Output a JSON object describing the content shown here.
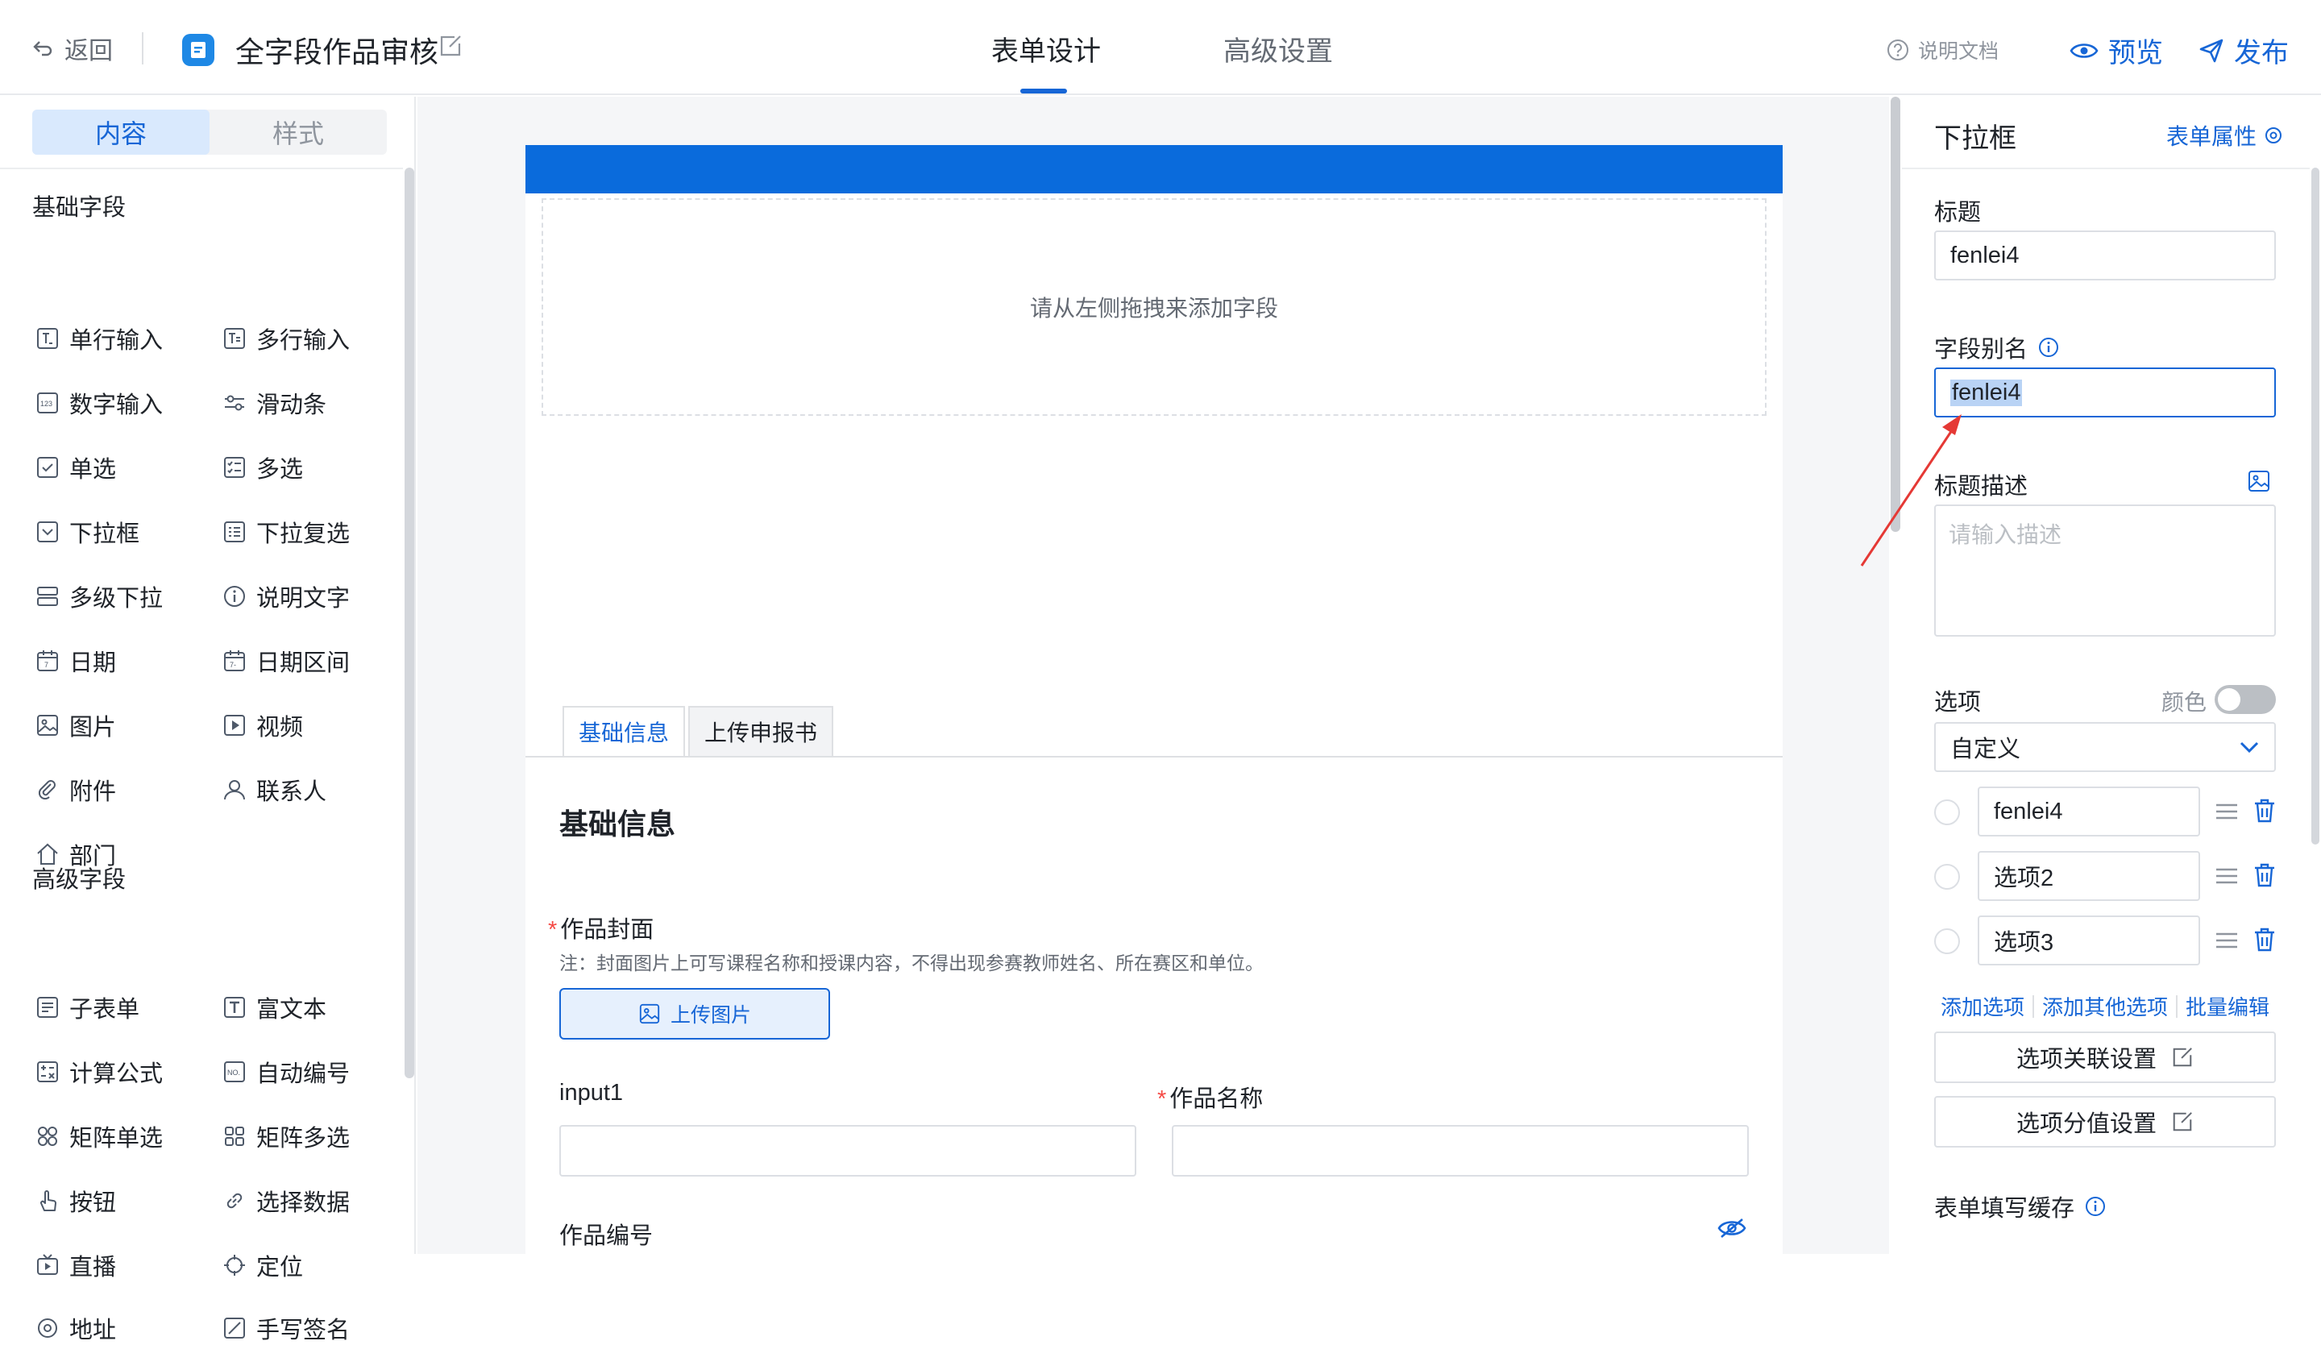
{
  "header": {
    "back_label": "返回",
    "app_title": "全字段作品审核",
    "tabs": [
      {
        "label": "表单设计"
      },
      {
        "label": "高级设置"
      }
    ],
    "active_tab": "表单设计",
    "help_label": "说明文档",
    "preview_label": "预览",
    "publish_label": "发布",
    "accent_color": "#1766d6"
  },
  "left_panel": {
    "tabs": [
      {
        "label": "内容"
      },
      {
        "label": "样式"
      }
    ],
    "basic_title": "基础字段",
    "basic_fields": [
      {
        "label": "单行输入",
        "icon": "text-input-icon"
      },
      {
        "label": "多行输入",
        "icon": "textarea-icon"
      },
      {
        "label": "数字输入",
        "icon": "number-icon"
      },
      {
        "label": "滑动条",
        "icon": "slider-icon"
      },
      {
        "label": "单选",
        "icon": "radio-icon"
      },
      {
        "label": "多选",
        "icon": "checkbox-icon"
      },
      {
        "label": "下拉框",
        "icon": "dropdown-icon"
      },
      {
        "label": "下拉复选",
        "icon": "dropdown-multi-icon"
      },
      {
        "label": "多级下拉",
        "icon": "cascader-icon"
      },
      {
        "label": "说明文字",
        "icon": "info-icon"
      },
      {
        "label": "日期",
        "icon": "date-icon"
      },
      {
        "label": "日期区间",
        "icon": "date-range-icon"
      },
      {
        "label": "图片",
        "icon": "image-icon"
      },
      {
        "label": "视频",
        "icon": "video-icon"
      },
      {
        "label": "附件",
        "icon": "paperclip-icon"
      },
      {
        "label": "联系人",
        "icon": "person-icon"
      },
      {
        "label": "部门",
        "icon": "home-icon"
      }
    ],
    "advanced_title": "高级字段",
    "advanced_fields": [
      {
        "label": "子表单",
        "icon": "subform-icon"
      },
      {
        "label": "富文本",
        "icon": "richtext-icon"
      },
      {
        "label": "计算公式",
        "icon": "formula-icon"
      },
      {
        "label": "自动编号",
        "icon": "auto-number-icon"
      },
      {
        "label": "矩阵单选",
        "icon": "matrix-radio-icon"
      },
      {
        "label": "矩阵多选",
        "icon": "matrix-checkbox-icon"
      },
      {
        "label": "按钮",
        "icon": "pointer-icon"
      },
      {
        "label": "选择数据",
        "icon": "link-icon"
      },
      {
        "label": "直播",
        "icon": "live-icon"
      },
      {
        "label": "定位",
        "icon": "location-icon"
      },
      {
        "label": "地址",
        "icon": "address-icon"
      },
      {
        "label": "手写签名",
        "icon": "signature-icon"
      }
    ]
  },
  "canvas": {
    "dropzone_text": "请从左侧拖拽来添加字段",
    "tabs": [
      {
        "label": "基础信息"
      },
      {
        "label": "上传申报书"
      }
    ],
    "group_title": "基础信息",
    "cover_label": "作品封面",
    "cover_note": "注：封面图片上可写课程名称和授课内容，不得出现参赛教师姓名、所在赛区和单位。",
    "upload_label": "上传图片",
    "input1_label": "input1",
    "name_label": "作品名称",
    "number_label": "作品编号"
  },
  "right_panel": {
    "title": "下拉框",
    "form_attr_label": "表单属性",
    "title_label": "标题",
    "title_value": "fenlei4",
    "alias_label": "字段别名",
    "alias_value": "fenlei4",
    "desc_label": "标题描述",
    "desc_placeholder": "请输入描述",
    "options_label": "选项",
    "color_label": "颜色",
    "option_source": "自定义",
    "options": [
      {
        "value": "fenlei4"
      },
      {
        "value": "选项2"
      },
      {
        "value": "选项3"
      }
    ],
    "add_option": "添加选项",
    "add_other_option": "添加其他选项",
    "bulk_edit": "批量编辑",
    "option_link_settings": "选项关联设置",
    "option_score_settings": "选项分值设置",
    "form_cache_label": "表单填写缓存"
  }
}
